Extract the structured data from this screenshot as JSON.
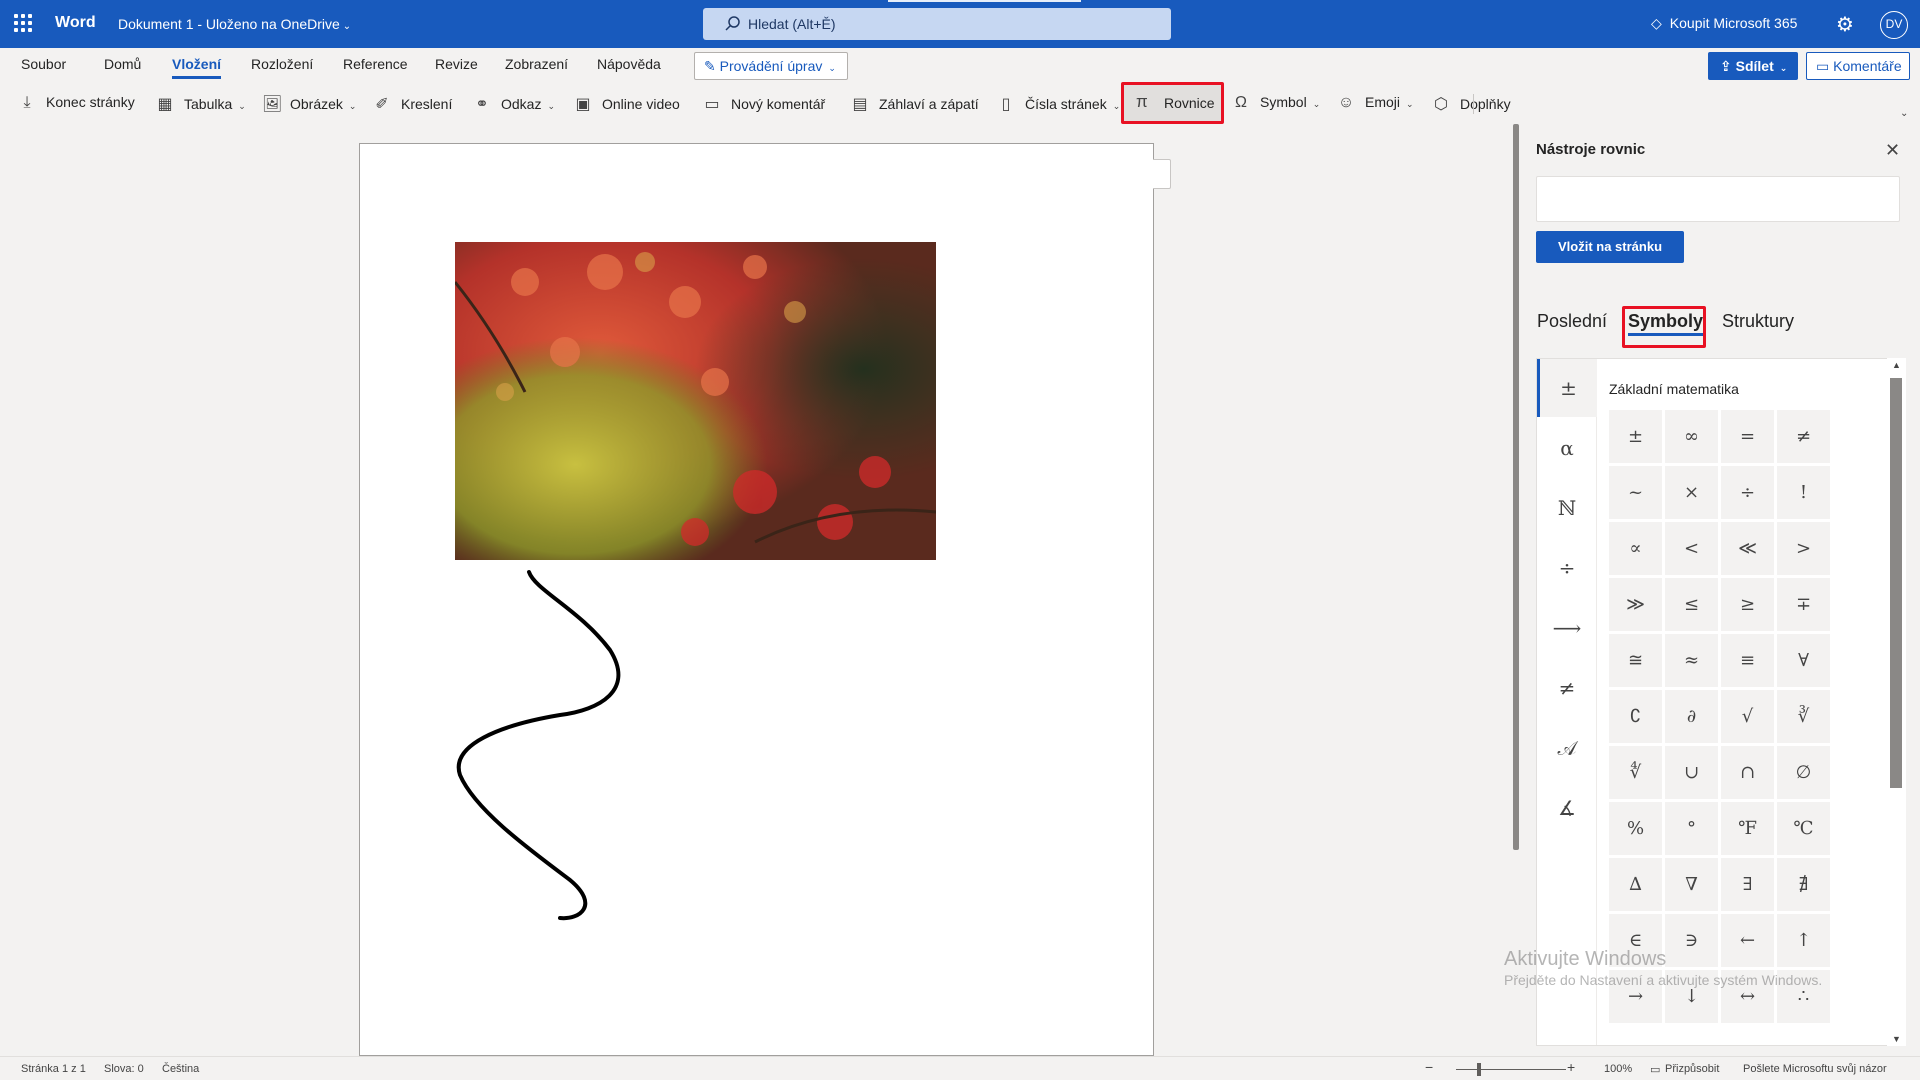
{
  "titlebar": {
    "app_name": "Word",
    "doc_name": "Dokument 1 - Uloženo na OneDrive",
    "search_placeholder": "Hledat (Alt+Ě)",
    "buy": "Koupit Microsoft 365",
    "avatar": "DV"
  },
  "tabs": [
    "Soubor",
    "Domů",
    "Vložení",
    "Rozložení",
    "Reference",
    "Revize",
    "Zobrazení",
    "Nápověda"
  ],
  "active_tab": "Vložení",
  "edit_mode": "Provádění úprav",
  "share": "Sdílet",
  "comments": "Komentáře",
  "ribbon": {
    "page_break": "Konec stránky",
    "table": "Tabulka",
    "picture": "Obrázek",
    "drawing": "Kreslení",
    "link": "Odkaz",
    "online_video": "Online video",
    "new_comment": "Nový komentář",
    "header_footer": "Záhlaví a zápatí",
    "page_numbers": "Čísla stránek",
    "equation": "Rovnice",
    "symbol": "Symbol",
    "emoji": "Emoji",
    "addins": "Doplňky"
  },
  "panel": {
    "title": "Nástroje rovnic",
    "insert": "Vložit na stránku",
    "tabs": [
      "Poslední",
      "Symboly",
      "Struktury"
    ],
    "active_tab": "Symboly",
    "category_title": "Základní matematika",
    "categories": [
      "±",
      "α",
      "ℕ",
      "÷",
      "⟶",
      "≠",
      "𝒜",
      "∡"
    ],
    "symbols": [
      "±",
      "∞",
      "=",
      "≠",
      "~",
      "×",
      "÷",
      "!",
      "∝",
      "<",
      "≪",
      ">",
      "≫",
      "≤",
      "≥",
      "∓",
      "≅",
      "≈",
      "≡",
      "∀",
      "∁",
      "∂",
      "√",
      "∛",
      "∜",
      "∪",
      "∩",
      "∅",
      "%",
      "°",
      "℉",
      "℃",
      "∆",
      "∇",
      "∃",
      "∄",
      "∈",
      "∋",
      "←",
      "↑",
      "→",
      "↓",
      "↔",
      "∴"
    ]
  },
  "watermark": {
    "line1": "Aktivujte Windows",
    "line2": "Přejděte do Nastavení a aktivujte systém Windows."
  },
  "status": {
    "page": "Stránka 1 z 1",
    "words": "Slova: 0",
    "language": "Čeština",
    "zoom": "100%",
    "fit": "Přizpůsobit",
    "feedback": "Pošlete Microsoftu svůj názor"
  },
  "colors": {
    "accent": "#185abd",
    "highlight": "#e81123"
  }
}
